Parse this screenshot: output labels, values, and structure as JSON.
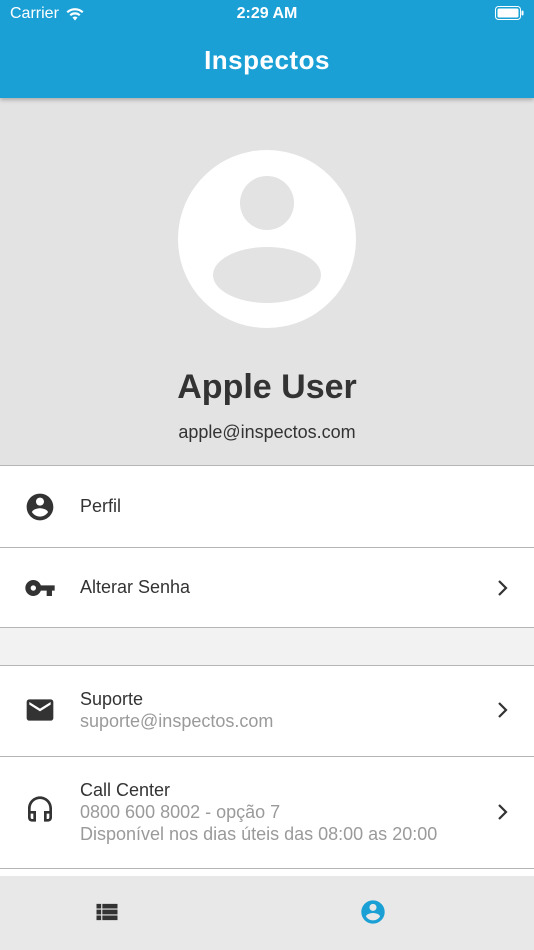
{
  "status_bar": {
    "carrier": "Carrier",
    "time": "2:29 AM"
  },
  "header": {
    "title": "Inspectos"
  },
  "profile": {
    "name": "Apple User",
    "email": "apple@inspectos.com"
  },
  "menu": {
    "perfil": {
      "label": "Perfil",
      "icon": "account-circle-icon"
    },
    "password": {
      "label": "Alterar Senha",
      "icon": "key-icon"
    },
    "support": {
      "label": "Suporte",
      "sub": "suporte@inspectos.com",
      "icon": "mail-icon"
    },
    "call_center": {
      "label": "Call Center",
      "sub1": "0800 600 8002 - opção 7",
      "sub2": "Disponível nos dias úteis das 08:00 as 20:00",
      "icon": "headset-icon"
    }
  },
  "tabs": [
    {
      "name": "list",
      "icon": "list-icon",
      "active": false
    },
    {
      "name": "profile",
      "icon": "account-circle-icon",
      "active": true
    }
  ],
  "colors": {
    "primary": "#1ba0d6",
    "text": "#333333",
    "subtext": "#9a9a9a",
    "background": "#e3e3e3"
  }
}
